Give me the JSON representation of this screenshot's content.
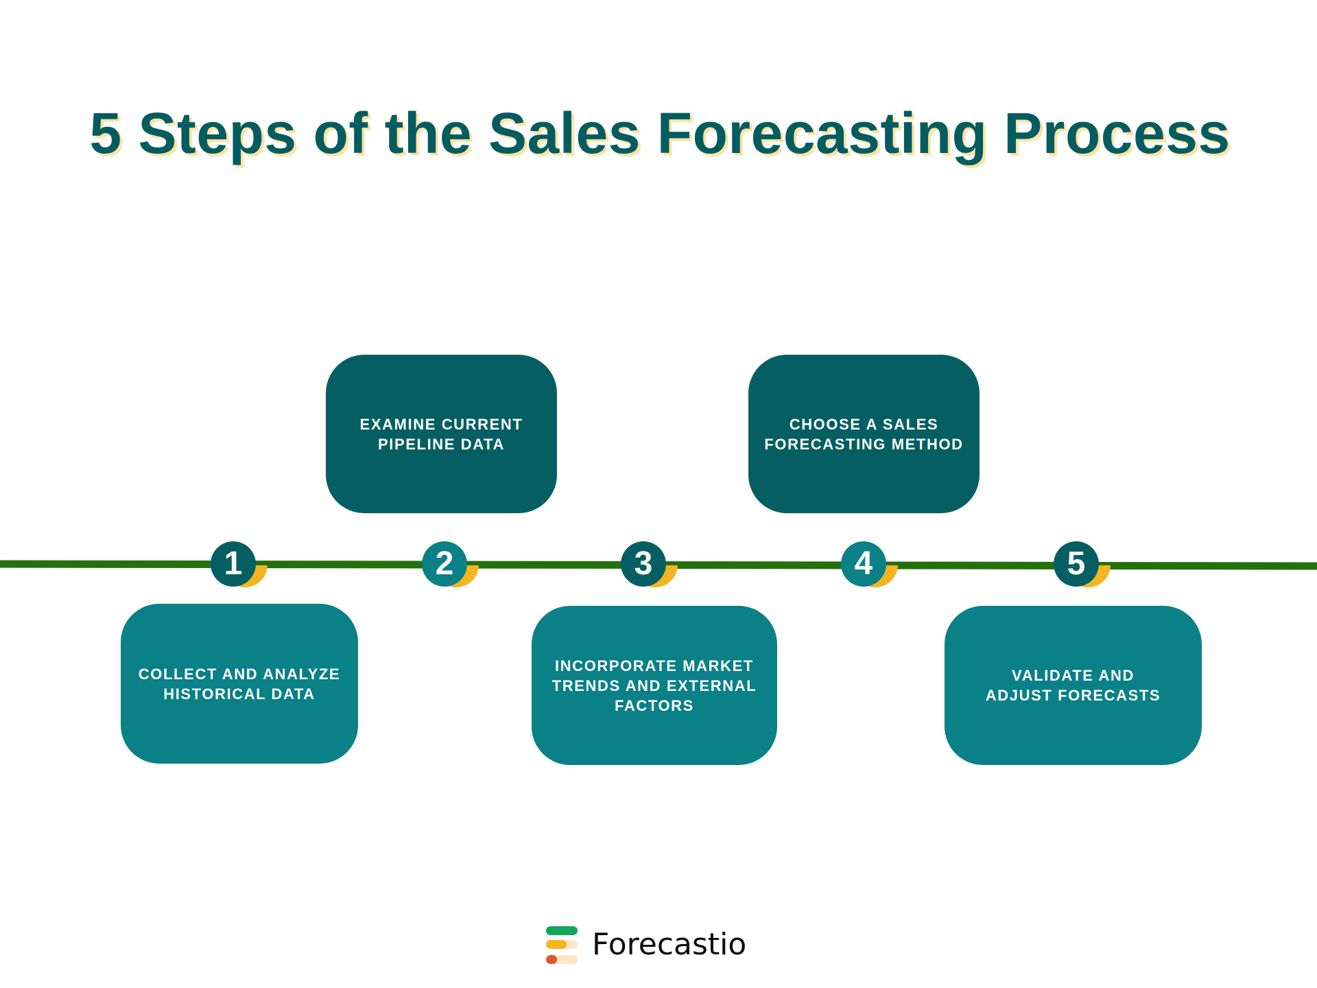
{
  "title": "5 Steps of the Sales Forecasting Process",
  "colors": {
    "title": "#055c60",
    "title_shadow": "#fde3a4",
    "timeline": "#24700b",
    "dark_teal": "#055f62",
    "light_teal": "#0a8087",
    "accent_yellow": "#f4b520"
  },
  "steps": [
    {
      "number": "1",
      "label": "COLLECT AND ANALYZE\nHISTORICAL DATA",
      "position": "below",
      "tone": "light",
      "badge_tone": "dark"
    },
    {
      "number": "2",
      "label": "EXAMINE CURRENT\nPIPELINE DATA",
      "position": "above",
      "tone": "dark",
      "badge_tone": "light"
    },
    {
      "number": "3",
      "label": "INCORPORATE MARKET\nTRENDS AND EXTERNAL\nFACTORS",
      "position": "below",
      "tone": "light",
      "badge_tone": "dark"
    },
    {
      "number": "4",
      "label": "CHOOSE A SALES\nFORECASTING METHOD",
      "position": "above",
      "tone": "dark",
      "badge_tone": "light"
    },
    {
      "number": "5",
      "label": "VALIDATE AND\nADJUST FORECASTS",
      "position": "below",
      "tone": "light",
      "badge_tone": "dark"
    }
  ],
  "logo": {
    "brand_name": "Forecastio",
    "icon": "forecastio-bars-logo-icon"
  }
}
